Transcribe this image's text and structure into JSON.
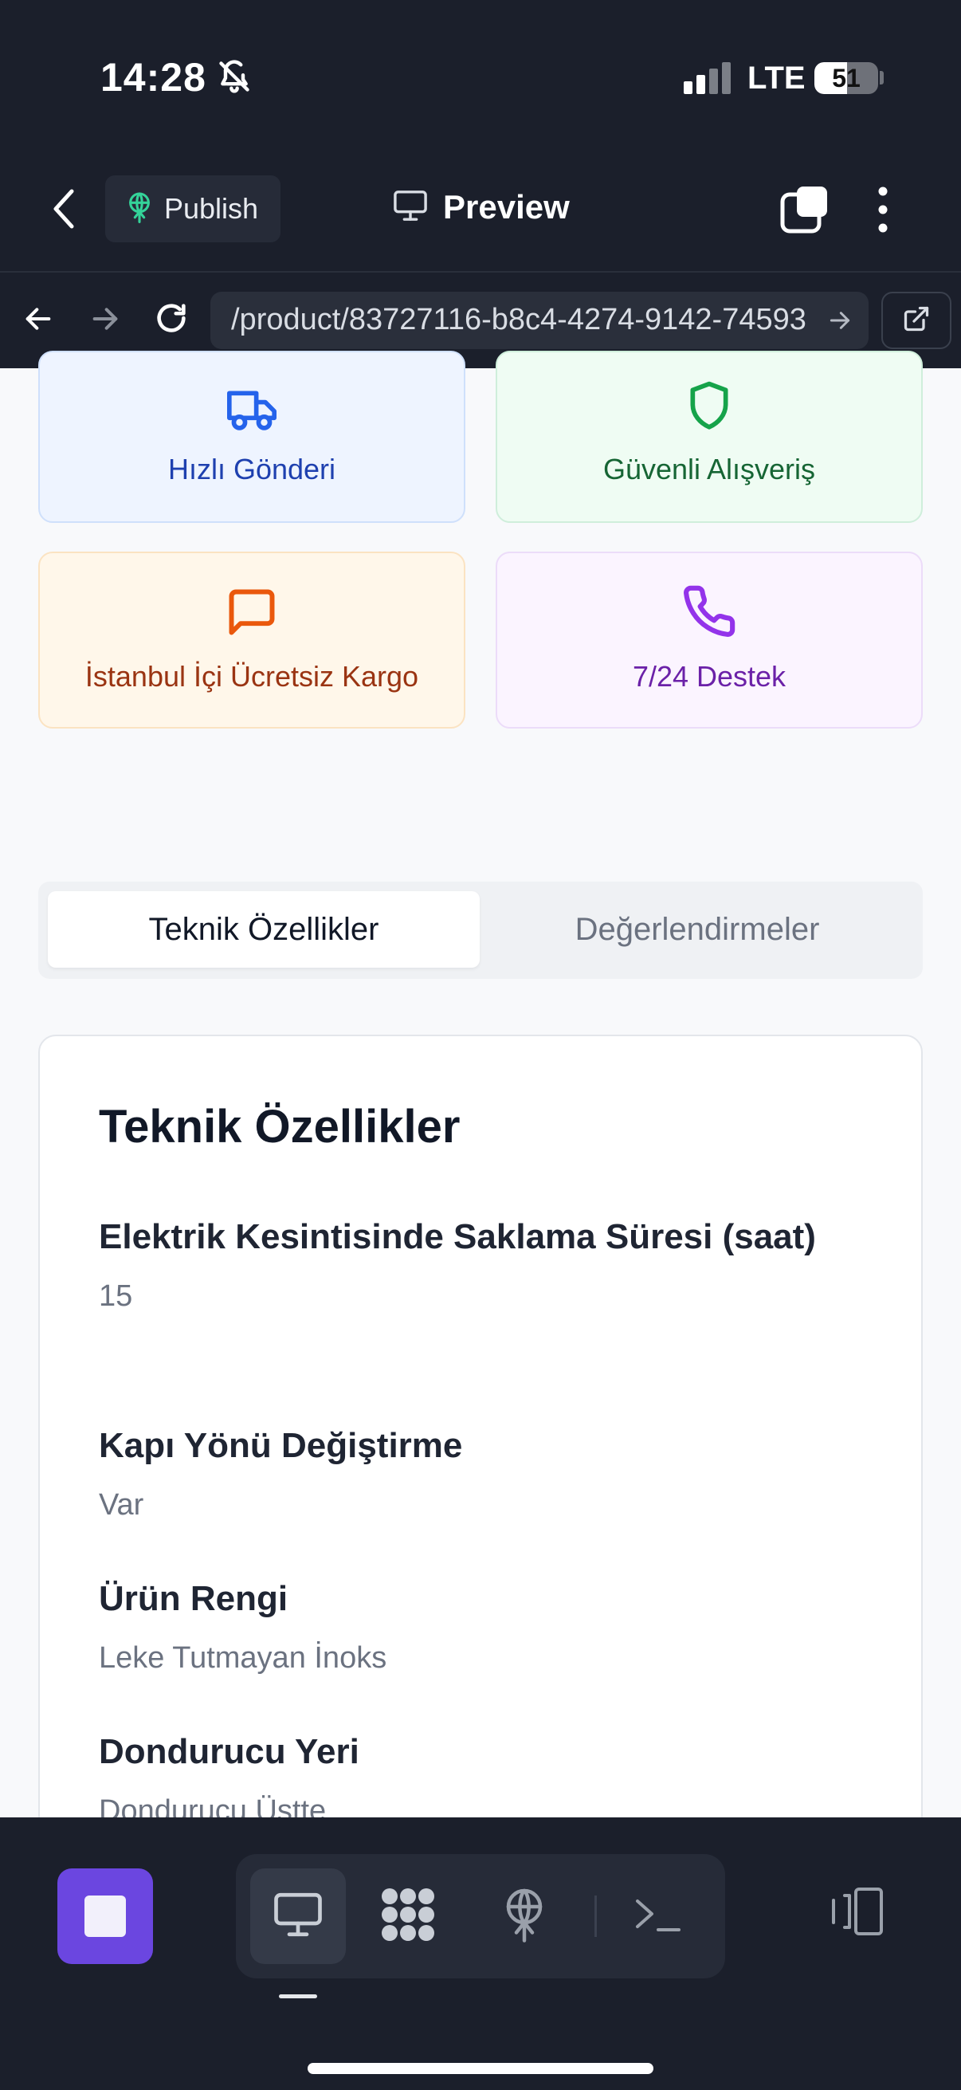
{
  "status_bar": {
    "time": "14:28",
    "network": "LTE",
    "battery": "51",
    "battery_level": 0.51
  },
  "app_bar": {
    "publish_label": "Publish",
    "preview_label": "Preview"
  },
  "browser": {
    "url": "/product/83727116-b8c4-4274-9142-74593"
  },
  "features": [
    {
      "label": "Hızlı Gönderi",
      "icon": "truck-icon",
      "color": "#2563eb",
      "text_color": "#1e40af"
    },
    {
      "label": "Güvenli Alışveriş",
      "icon": "shield-icon",
      "color": "#16a34a",
      "text_color": "#166534"
    },
    {
      "label": "İstanbul İçi Ücretsiz Kargo",
      "icon": "message-square-icon",
      "color": "#ea580c",
      "text_color": "#9a3412"
    },
    {
      "label": "7/24 Destek",
      "icon": "phone-icon",
      "color": "#9333ea",
      "text_color": "#6b21a8"
    }
  ],
  "tabs": [
    {
      "label": "Teknik Özellikler",
      "active": true
    },
    {
      "label": "Değerlendirmeler",
      "active": false
    }
  ],
  "specs": {
    "title": "Teknik Özellikler",
    "items": [
      {
        "label": "Elektrik Kesintisinde Saklama Süresi (saat)",
        "value": "15"
      },
      {
        "label": "Kapı Yönü Değiştirme",
        "value": "Var"
      },
      {
        "label": "Ürün Rengi",
        "value": "Leke Tutmayan İnoks"
      },
      {
        "label": "Dondurucu Yeri",
        "value": "Dondurucu Üstte"
      }
    ]
  },
  "colors": {
    "bar_background": "#1b1f2b",
    "accent_purple": "#6b46e0"
  }
}
